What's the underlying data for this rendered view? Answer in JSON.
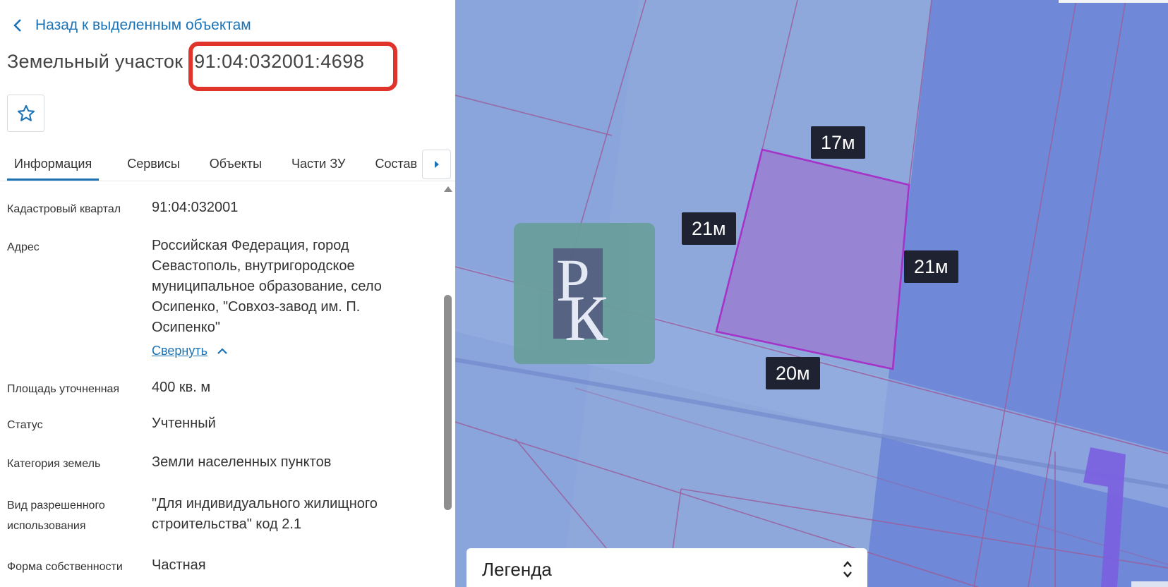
{
  "panel": {
    "back_label": "Назад к выделенным объектам",
    "title_label": "Земельный участок",
    "cadastral_id": "91:04:032001:4698",
    "tabs": [
      {
        "label": "Информация",
        "active": true
      },
      {
        "label": "Сервисы",
        "active": false
      },
      {
        "label": "Объекты",
        "active": false
      },
      {
        "label": "Части ЗУ",
        "active": false
      },
      {
        "label": "Состав",
        "active": false
      }
    ],
    "properties": {
      "quarter": {
        "label": "Кадастровый квартал",
        "value": "91:04:032001"
      },
      "address": {
        "label": "Адрес",
        "value": "Российская Федерация, город Севастополь, внутригородское муниципальное образование, село Осипенко, \"Совхоз-завод им. П. Осипенко\"",
        "collapse_label": "Свернуть"
      },
      "area": {
        "label": "Площадь уточненная",
        "value": "400 кв. м"
      },
      "status": {
        "label": "Статус",
        "value": "Учтенный"
      },
      "category": {
        "label": "Категория земель",
        "value": "Земли населенных пунктов"
      },
      "use": {
        "label": "Вид разрешенного использования",
        "value": "\"Для индивидуального жилищного строительства\" код 2.1"
      },
      "ownership": {
        "label": "Форма собственности",
        "value": "Частная"
      }
    }
  },
  "map": {
    "dimensions": {
      "top": "17м",
      "left": "21м",
      "right": "21м",
      "bottom": "20м"
    },
    "logo_text": "РК",
    "legend_label": "Легенда"
  },
  "colors": {
    "accent": "#1b73b5",
    "highlight": "#e0332c",
    "parcel_fill": "#9785d3",
    "parcel_border": "#a633c8",
    "map_base": "#8ea8dc",
    "map_dark": "#6f88d8"
  },
  "icons": {
    "back": "chevron-left-icon",
    "favorite": "star-icon",
    "tabs_next": "caret-right-icon",
    "collapse": "chevron-up-icon",
    "legend_toggle": "chevron-up-down-icon"
  }
}
